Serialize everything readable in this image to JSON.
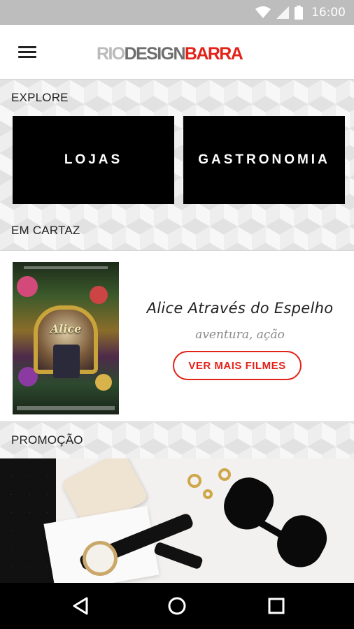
{
  "status_bar": {
    "time": "16:00"
  },
  "header": {
    "logo": {
      "part1": "RIO",
      "part2": "DESIGN",
      "part3": "BARRA"
    }
  },
  "explore": {
    "label": "EXPLORE",
    "tiles": [
      {
        "label": "LOJAS"
      },
      {
        "label": "GASTRONOMIA"
      }
    ]
  },
  "em_cartaz": {
    "label": "EM CARTAZ",
    "movie": {
      "title": "Alice Através do  Espelho",
      "genre": "aventura, ação",
      "poster_title": "Alice"
    },
    "more_button_label": "VER MAIS FILMES"
  },
  "promocao": {
    "label": "PROMOÇÃO"
  },
  "colors": {
    "accent": "#e2231a",
    "tile_bg": "#000000",
    "status_bar": "#bdbdbd"
  },
  "icons": {
    "status": [
      "wifi-icon",
      "signal-icon",
      "battery-icon"
    ],
    "header": "menu-icon",
    "nav": [
      "back-icon",
      "home-icon",
      "recents-icon"
    ]
  }
}
